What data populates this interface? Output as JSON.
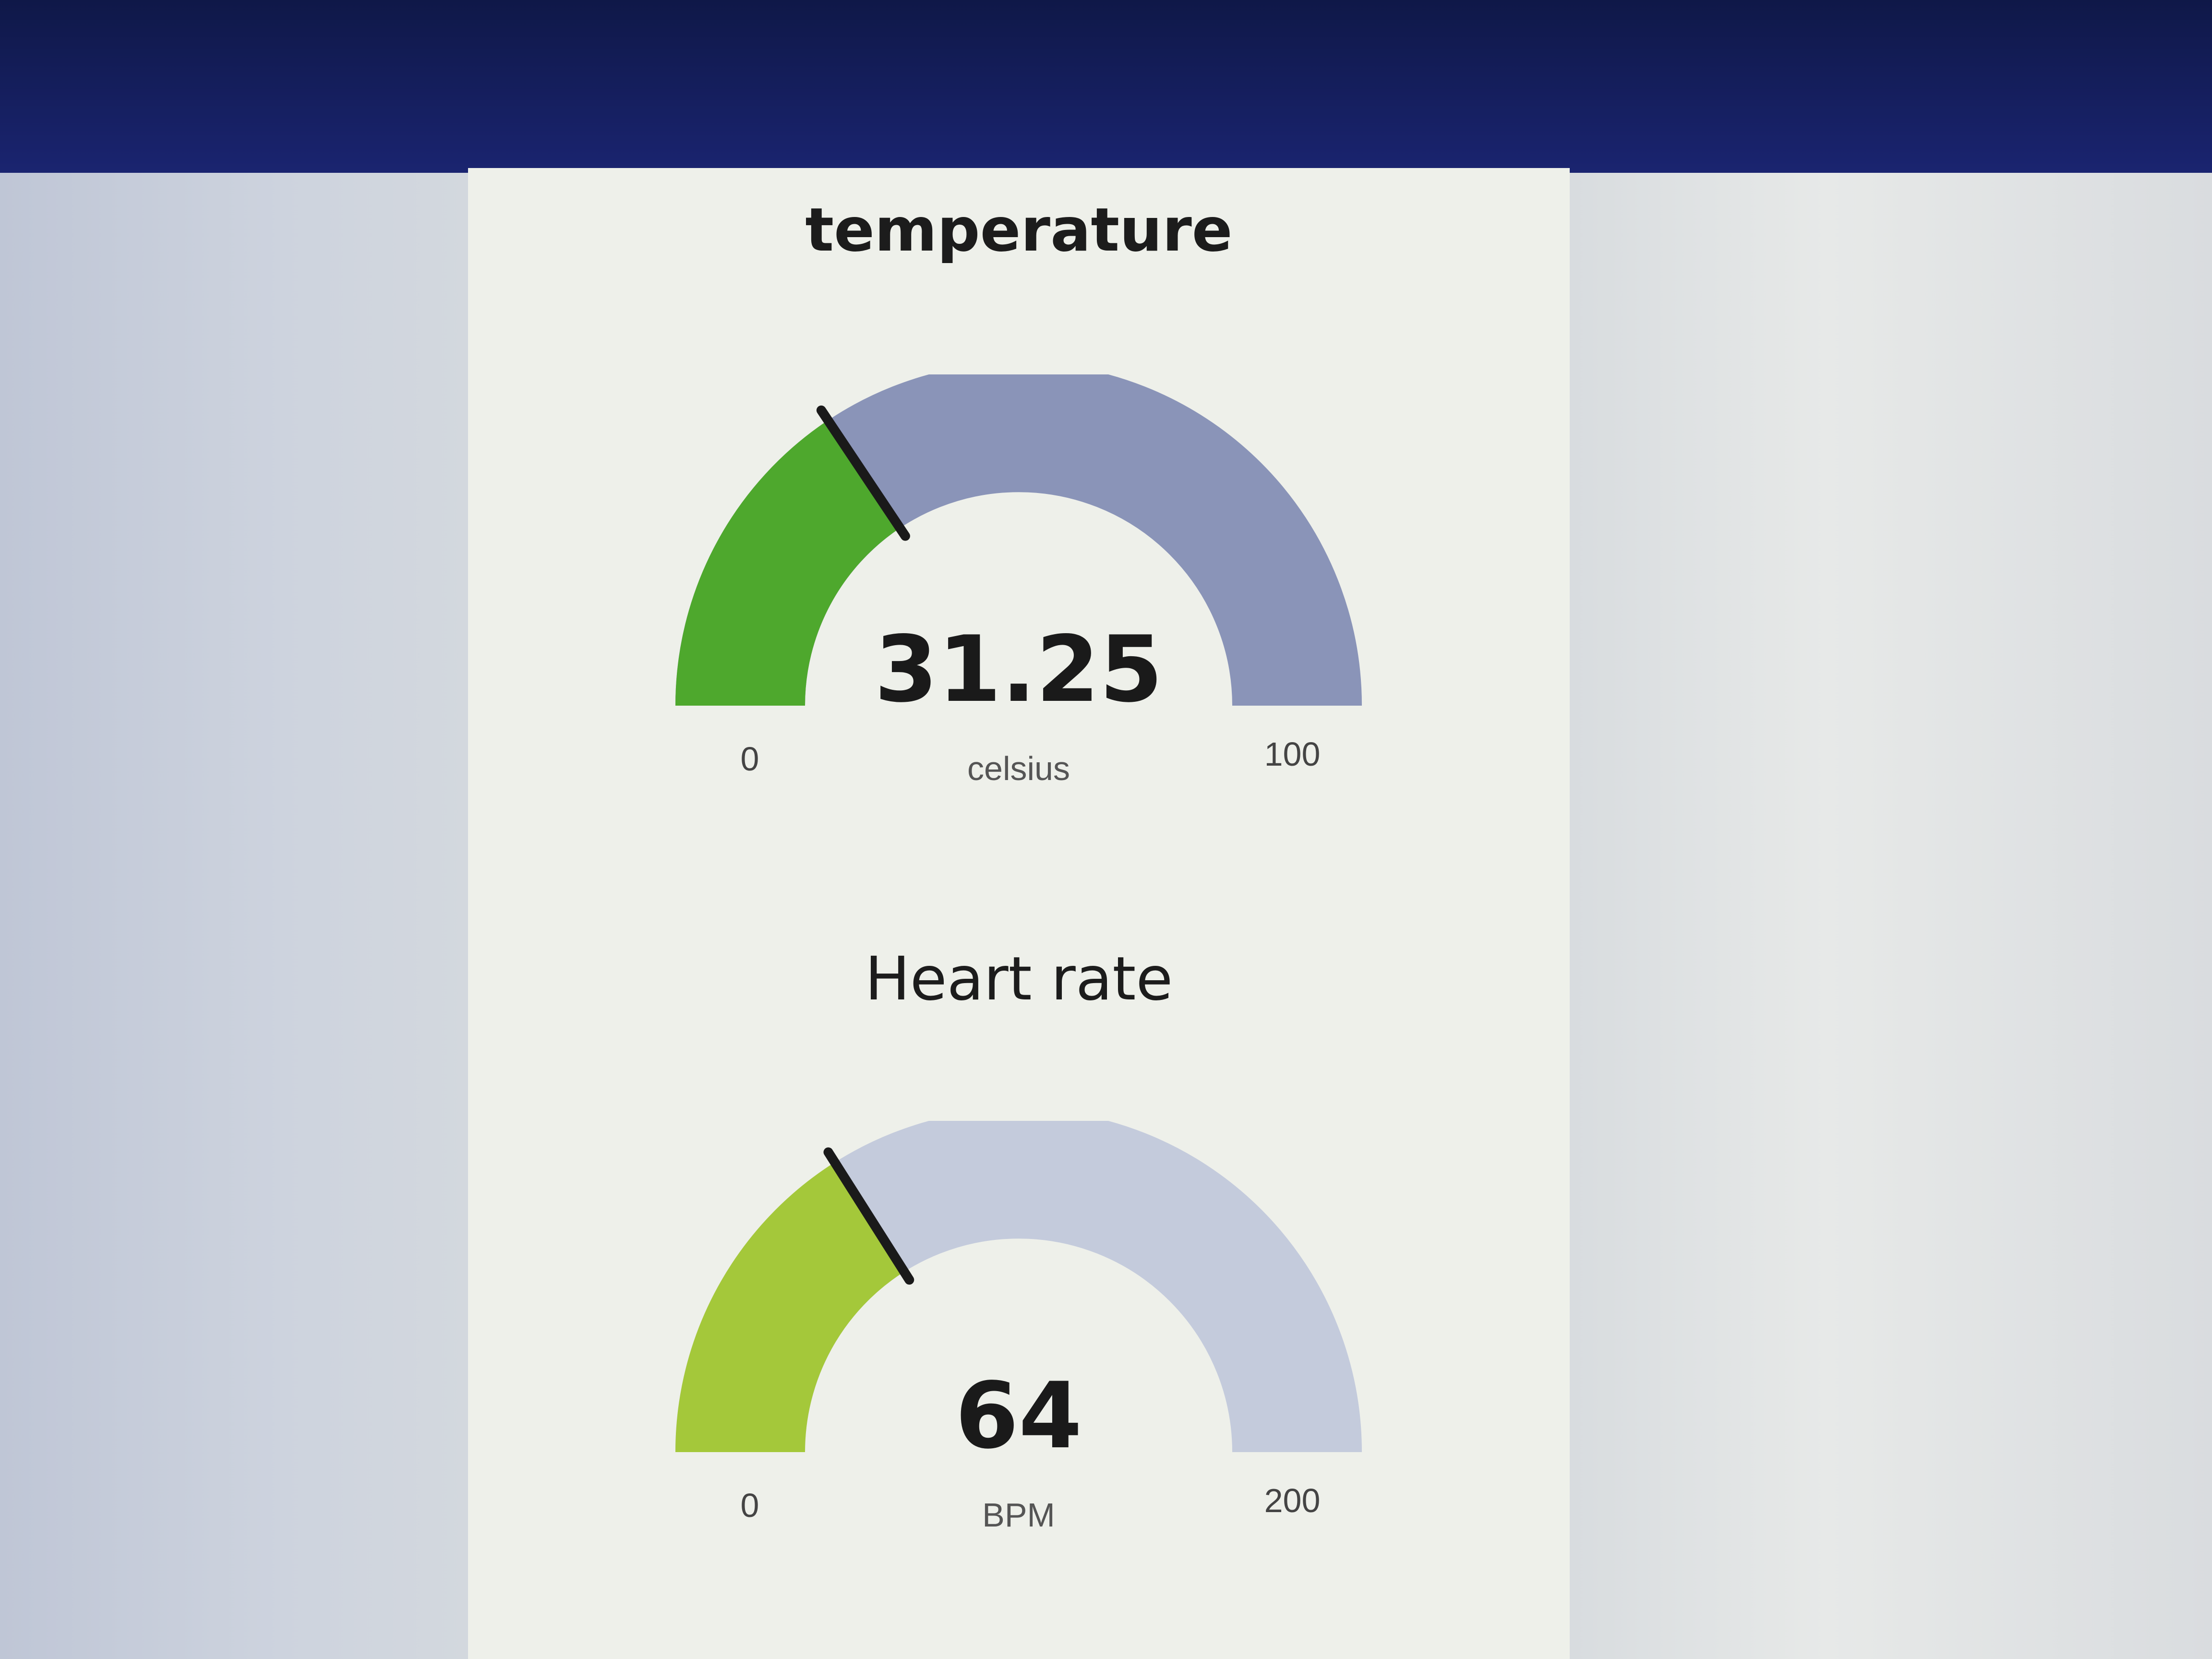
{
  "gauges": [
    {
      "id": "temperature",
      "title": "temperature",
      "value": 31.25,
      "value_label": "31.25",
      "unit": "celsius",
      "min": 0,
      "max": 100,
      "min_label": "0",
      "max_label": "100",
      "fill_color": "#4ea82d",
      "track_color": "#8a94b8"
    },
    {
      "id": "heart-rate",
      "title": "Heart rate",
      "value": 64,
      "value_label": "64",
      "unit": "BPM",
      "min": 0,
      "max": 200,
      "min_label": "0",
      "max_label": "200",
      "fill_color": "#a4c83a",
      "track_color": "#c4cbdc"
    }
  ]
}
